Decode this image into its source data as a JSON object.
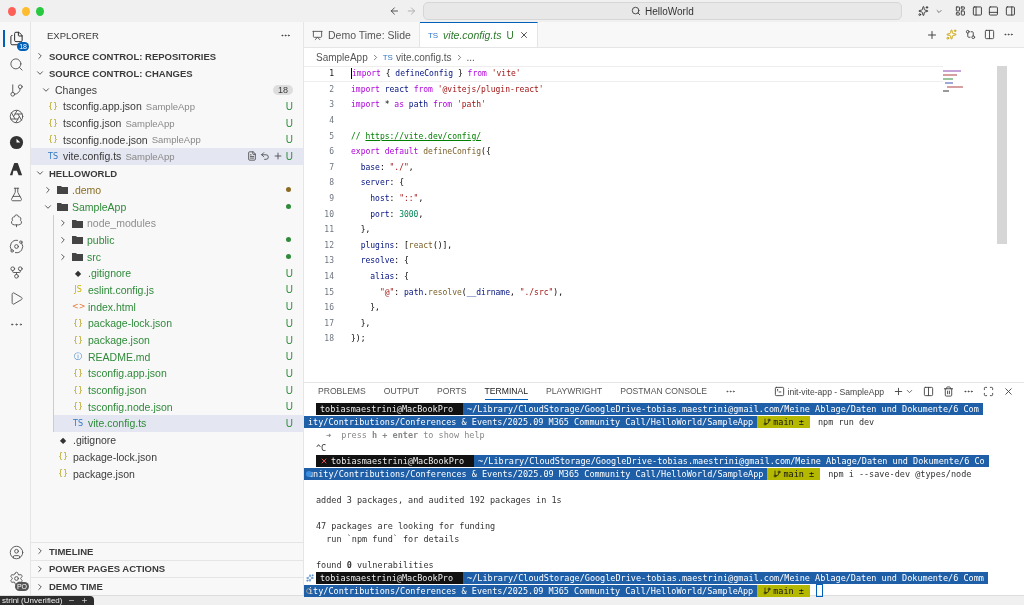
{
  "window": {
    "search": "HelloWorld"
  },
  "activity_bar": {
    "items": [
      {
        "badge": "18",
        "selected": true
      },
      {
        "selected": false
      },
      {
        "selected": false
      },
      {
        "selected": false
      },
      {
        "selected": false
      },
      {
        "selected": false
      },
      {
        "selected": false
      },
      {
        "selected": false
      },
      {
        "selected": false
      },
      {
        "selected": false
      },
      {
        "selected": false
      },
      {
        "selected": false
      }
    ],
    "bottom": [
      {
        "selected": false
      },
      {
        "badge": "PO",
        "selected": false
      }
    ]
  },
  "sidebar": {
    "title": "EXPLORER",
    "repositories": {
      "title": "SOURCE CONTROL: REPOSITORIES",
      "expanded": false
    },
    "changes": {
      "title": "SOURCE CONTROL: CHANGES",
      "expanded": true,
      "group": {
        "label": "Changes",
        "count": "18",
        "expanded": true
      },
      "files": [
        {
          "name": "tsconfig.app.json",
          "folder": "SampleApp",
          "icon": "{}",
          "kind": "json",
          "badge": "U",
          "selected": false
        },
        {
          "name": "tsconfig.json",
          "folder": "SampleApp",
          "icon": "{}",
          "kind": "json",
          "badge": "U",
          "selected": false
        },
        {
          "name": "tsconfig.node.json",
          "folder": "SampleApp",
          "icon": "{}",
          "kind": "json",
          "badge": "U",
          "selected": false
        },
        {
          "name": "vite.config.ts",
          "folder": "SampleApp",
          "icon": "TS",
          "kind": "ts",
          "badge": "U",
          "selected": true
        }
      ]
    },
    "workspace": {
      "title": "HELLOWORLD",
      "expanded": true,
      "tree": [
        {
          "name": ".demo",
          "kind": "folder",
          "expanded": false,
          "color": "#8a6d25",
          "dot": true,
          "selected": false
        },
        {
          "name": "SampleApp",
          "kind": "folder",
          "expanded": true,
          "color": "#2f8a3a",
          "dot": true,
          "selected": false,
          "children": [
            {
              "name": "node_modules",
              "kind": "folder",
              "expanded": false,
              "color": "#8e8e8e",
              "dot": false,
              "selected": false
            },
            {
              "name": "public",
              "kind": "folder",
              "expanded": false,
              "color": "#2f8a3a",
              "dot": true,
              "selected": false
            },
            {
              "name": "src",
              "kind": "folder",
              "expanded": false,
              "color": "#2f8a3a",
              "dot": true,
              "selected": false
            },
            {
              "name": ".gitignore",
              "kind": "git",
              "icon": "◆",
              "badge": "U",
              "selected": false
            },
            {
              "name": "eslint.config.js",
              "kind": "js",
              "icon": "JS",
              "badge": "U",
              "selected": false
            },
            {
              "name": "index.html",
              "kind": "html",
              "icon": "<>",
              "badge": "U",
              "selected": false
            },
            {
              "name": "package-lock.json",
              "kind": "json",
              "icon": "{}",
              "badge": "U",
              "selected": false
            },
            {
              "name": "package.json",
              "kind": "json",
              "icon": "{}",
              "badge": "U",
              "selected": false
            },
            {
              "name": "README.md",
              "kind": "info",
              "icon": "ⓘ",
              "badge": "U",
              "selected": false
            },
            {
              "name": "tsconfig.app.json",
              "kind": "json",
              "icon": "{}",
              "badge": "U",
              "selected": false
            },
            {
              "name": "tsconfig.json",
              "kind": "json",
              "icon": "{}",
              "badge": "U",
              "selected": false
            },
            {
              "name": "tsconfig.node.json",
              "kind": "json",
              "icon": "{}",
              "badge": "U",
              "selected": false
            },
            {
              "name": "vite.config.ts",
              "kind": "ts",
              "icon": "TS",
              "badge": "U",
              "selected": true
            }
          ]
        },
        {
          "name": ".gitignore",
          "kind": "git",
          "icon": "◆",
          "selected": false
        },
        {
          "name": "package-lock.json",
          "kind": "json",
          "icon": "{}",
          "selected": false
        },
        {
          "name": "package.json",
          "kind": "json",
          "icon": "{}",
          "selected": false
        }
      ]
    },
    "bottom_sections": [
      {
        "title": "TIMELINE",
        "expanded": false
      },
      {
        "title": "POWER PAGES ACTIONS",
        "expanded": false
      },
      {
        "title": "DEMO TIME",
        "expanded": false
      }
    ]
  },
  "editor": {
    "tabs": [
      {
        "label": "Demo Time: Slide",
        "kind": "slide",
        "selected": false
      },
      {
        "label": "vite.config.ts",
        "kind": "file",
        "icon": "TS",
        "selected": true,
        "badge": "U"
      }
    ],
    "breadcrumb": {
      "folder": "SampleApp",
      "file_icon": "TS",
      "file": "vite.config.ts",
      "more": "..."
    },
    "lines": [
      {
        "number": "1",
        "current": true,
        "tokens": [
          {
            "text": "import",
            "kind": "kw"
          },
          {
            "text": " { ",
            "kind": "p"
          },
          {
            "text": "defineConfig",
            "kind": "v"
          },
          {
            "text": " } ",
            "kind": "p"
          },
          {
            "text": "from",
            "kind": "kw"
          },
          {
            "text": " 'vite'",
            "kind": "s"
          }
        ]
      },
      {
        "number": "2",
        "current": false,
        "tokens": [
          {
            "text": "import",
            "kind": "kw"
          },
          {
            "text": " react ",
            "kind": "v"
          },
          {
            "text": "from",
            "kind": "kw"
          },
          {
            "text": " '@vitejs/plugin-react'",
            "kind": "s"
          }
        ]
      },
      {
        "number": "3",
        "current": false,
        "tokens": [
          {
            "text": "import",
            "kind": "kw"
          },
          {
            "text": " * ",
            "kind": "p"
          },
          {
            "text": "as",
            "kind": "kw"
          },
          {
            "text": " path ",
            "kind": "v"
          },
          {
            "text": "from",
            "kind": "kw"
          },
          {
            "text": " 'path'",
            "kind": "s"
          }
        ]
      },
      {
        "number": "4",
        "current": false
      },
      {
        "number": "5",
        "current": false,
        "tokens": [
          {
            "text": "// ",
            "kind": "c"
          },
          {
            "text": "https://vite.dev/config/",
            "kind": "link"
          }
        ]
      },
      {
        "number": "6",
        "current": false,
        "tokens": [
          {
            "text": "export default",
            "kind": "kw"
          },
          {
            "text": " defineConfig",
            "kind": "f"
          },
          {
            "text": "({",
            "kind": "p"
          }
        ]
      },
      {
        "number": "7",
        "current": false,
        "tokens": [
          {
            "text": "  base",
            "kind": "v"
          },
          {
            "text": ": ",
            "kind": "p"
          },
          {
            "text": "\"./\"",
            "kind": "s"
          },
          {
            "text": ",",
            "kind": "p"
          }
        ]
      },
      {
        "number": "8",
        "current": false,
        "tokens": [
          {
            "text": "  server",
            "kind": "v"
          },
          {
            "text": ": {",
            "kind": "p"
          }
        ]
      },
      {
        "number": "9",
        "current": false,
        "tokens": [
          {
            "text": "    host",
            "kind": "v"
          },
          {
            "text": ": ",
            "kind": "p"
          },
          {
            "text": "\"::\"",
            "kind": "s"
          },
          {
            "text": ",",
            "kind": "p"
          }
        ]
      },
      {
        "number": "10",
        "current": false,
        "tokens": [
          {
            "text": "    port",
            "kind": "v"
          },
          {
            "text": ": ",
            "kind": "p"
          },
          {
            "text": "3000",
            "kind": "n"
          },
          {
            "text": ",",
            "kind": "p"
          }
        ]
      },
      {
        "number": "11",
        "current": false,
        "tokens": [
          {
            "text": "  },",
            "kind": "p"
          }
        ]
      },
      {
        "number": "12",
        "current": false,
        "tokens": [
          {
            "text": "  plugins",
            "kind": "v"
          },
          {
            "text": ": [",
            "kind": "p"
          },
          {
            "text": "react",
            "kind": "f"
          },
          {
            "text": "()],",
            "kind": "p"
          }
        ]
      },
      {
        "number": "13",
        "current": false,
        "tokens": [
          {
            "text": "  resolve",
            "kind": "v"
          },
          {
            "text": ": {",
            "kind": "p"
          }
        ]
      },
      {
        "number": "14",
        "current": false,
        "tokens": [
          {
            "text": "    alias",
            "kind": "v"
          },
          {
            "text": ": {",
            "kind": "p"
          }
        ]
      },
      {
        "number": "15",
        "current": false,
        "tokens": [
          {
            "text": "      \"@\"",
            "kind": "s"
          },
          {
            "text": ": ",
            "kind": "p"
          },
          {
            "text": "path",
            "kind": "v"
          },
          {
            "text": ".",
            "kind": "p"
          },
          {
            "text": "resolve",
            "kind": "f"
          },
          {
            "text": "(",
            "kind": "p"
          },
          {
            "text": "__dirname",
            "kind": "v"
          },
          {
            "text": ", ",
            "kind": "p"
          },
          {
            "text": "\"./src\"",
            "kind": "s"
          },
          {
            "text": "),",
            "kind": "p"
          }
        ]
      },
      {
        "number": "16",
        "current": false,
        "tokens": [
          {
            "text": "    },",
            "kind": "p"
          }
        ]
      },
      {
        "number": "17",
        "current": false,
        "tokens": [
          {
            "text": "  },",
            "kind": "p"
          }
        ]
      },
      {
        "number": "18",
        "current": false,
        "tokens": [
          {
            "text": "});",
            "kind": "p"
          }
        ]
      }
    ]
  },
  "panel": {
    "tabs": [
      {
        "label": "PROBLEMS",
        "selected": false
      },
      {
        "label": "OUTPUT",
        "selected": false
      },
      {
        "label": "PORTS",
        "selected": false
      },
      {
        "label": "TERMINAL",
        "selected": true
      },
      {
        "label": "PLAYWRIGHT",
        "selected": false
      },
      {
        "label": "POSTMAN CONSOLE",
        "selected": false
      }
    ],
    "terminal_name": "init-vite-app - SampleApp",
    "lines": [
      {
        "kind": "prompt",
        "failed": false,
        "cursor": false,
        "user": "tobiasmaestrini@MacBookPro",
        "path_start": "~/Library/CloudStorage/GoogleDrive-tobias.maestrini@gmail.com/Meine Ablage/Daten und Dokumente/6 Com",
        "path_end": "ity/Contributions/Conferences & Events/2025.09 M365 Community Call/HelloWorld/SampleApp",
        "branch": "main ±",
        "command": "npm run dev"
      },
      {
        "kind": "hint",
        "text": "➜  press **h + enter** to show help"
      },
      {
        "kind": "text",
        "text": "^C"
      },
      {
        "kind": "prompt",
        "failed": true,
        "cursor": false,
        "user": "tobiasmaestrini@MacBookPro",
        "path_start": "~/Library/CloudStorage/GoogleDrive-tobias.maestrini@gmail.com/Meine Ablage/Daten und Dokumente/6 Co",
        "path_end": "unity/Contributions/Conferences & Events/2025.09 M365 Community Call/HelloWorld/SampleApp",
        "branch": "main ±",
        "command": "npm i --save-dev @types/node"
      },
      {
        "kind": "blank"
      },
      {
        "kind": "text",
        "text": "added 3 packages, and audited 192 packages in 1s"
      },
      {
        "kind": "blank"
      },
      {
        "kind": "text",
        "text": "47 packages are looking for funding"
      },
      {
        "kind": "text",
        "text": "  run `npm fund` for details"
      },
      {
        "kind": "blank"
      },
      {
        "kind": "text",
        "text": "found **0** vulnerabilities"
      },
      {
        "kind": "prompt",
        "failed": false,
        "cursor": true,
        "user": "tobiasmaestrini@MacBookPro",
        "path_start": "~/Library/CloudStorage/GoogleDrive-tobias.maestrini@gmail.com/Meine Ablage/Daten und Dokumente/6 Comm",
        "path_end": "ity/Contributions/Conferences & Events/2025.09 M365 Community Call/HelloWorld/SampleApp",
        "branch": "main ±"
      }
    ]
  },
  "overlay": {
    "label": "strini (Unverified)"
  }
}
